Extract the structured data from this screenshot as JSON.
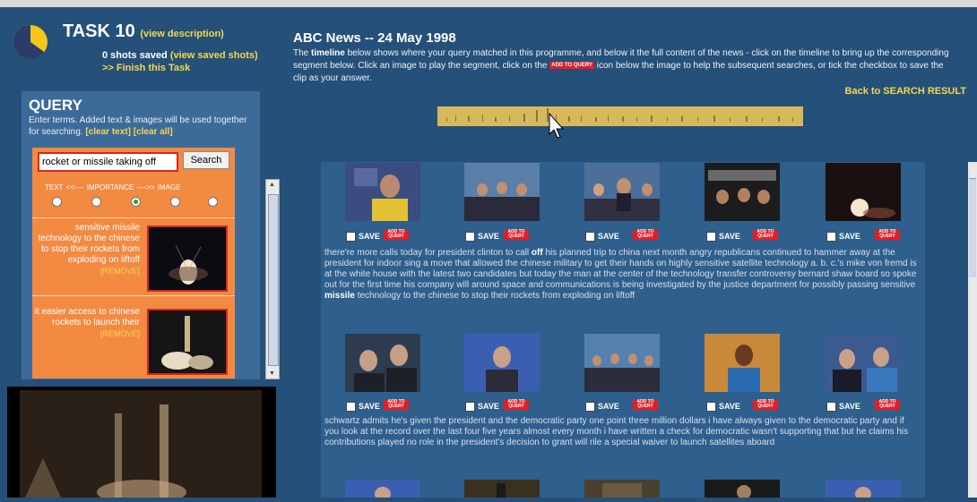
{
  "task": {
    "title": "TASK 10",
    "view_description": "(view description)",
    "shots_saved_count": "0 shots saved",
    "view_saved_shots": "(view saved shots)",
    "finish": ">> Finish this Task",
    "progress_fraction": 0.35
  },
  "query": {
    "title": "QUERY",
    "help_text": "Enter terms. Added text & images will be used together for searching.",
    "clear_text": "[clear text]",
    "clear_all": "[clear all]",
    "input_value": "rocket or missile taking off",
    "search_label": "Search",
    "importance_scale": "TEXT <<----        IMPORTANCE      ---->> IMAGE",
    "importance_selected_index": 2,
    "items": [
      {
        "text": "sensitive missile technology to the chinese to stop their rockets from exploding on liftoff",
        "remove": "[REMOVE]"
      },
      {
        "text": "it easier access to chinese rockets to launch their",
        "remove": "[REMOVE]"
      }
    ]
  },
  "programme": {
    "title": "ABC News -- 24 May 1998",
    "desc_1": "The ",
    "desc_bold": "timeline",
    "desc_2": " below shows where your query matched in this programme, and below it the full content of the news - click on the timeline to bring up the corresponding segment below. Click an image to play the segment, click on the ",
    "desc_3": " icon below the image to help the subsequent searches, or tick the checkbox to save the clip as your answer.",
    "add_query_icon": "ADD TO QUERY",
    "back_link": "Back to SEARCH RESULT"
  },
  "shot_labels": {
    "save": "SAVE",
    "add_to_query": "ADD TO QUERY"
  },
  "segments": [
    {
      "transcript_1": "there're more calls today for president clinton to call ",
      "transcript_b1": "off",
      "transcript_2": " his planned trip to china next month angry republicans continued to hammer away at the president for indoor sing a move that allowed the chinese military to get their hands on highly sensitive satellite technology a. b. c.'s mike von fremd is at the white house with the latest two candidates but today the man at the center of the technology transfer controversy bernard shaw board so spoke out for the first time his company will around space and communications is being investigated by the justice department for possibly passing sensitive ",
      "transcript_b2": "missile",
      "transcript_3": " technology to the chinese to stop their rockets from exploding on liftoff"
    },
    {
      "transcript_1": "schwartz admits he's given the president and the democratic party one point three million dollars i have always given to the democratic party and if you look at the record over the last four five years almost every month i have written a check for democratic wasn't supporting that but he claims his contributions played no role in the president's decision to grant will rile a special waiver to launch satellites aboard"
    }
  ],
  "colors": {
    "background": "#24507a",
    "panel": "#3c6b9a",
    "orange_panel": "#f28a42",
    "accent_yellow": "#f5d84a",
    "add_red": "#e31e24",
    "timeline": "#d7b95c"
  }
}
